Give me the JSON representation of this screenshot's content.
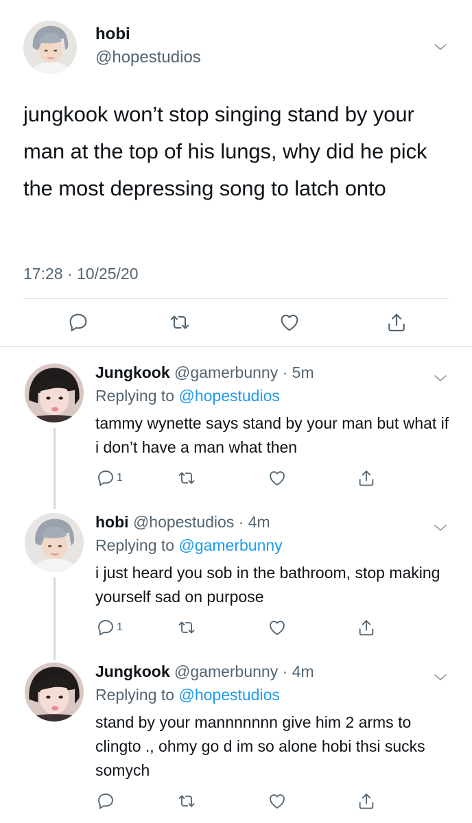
{
  "main_tweet": {
    "name": "hobi",
    "handle": "@hopestudios",
    "text": "jungkook won’t stop singing stand by your man at the top of his lungs, why did he pick the most depressing song to latch onto",
    "timestamp": "17:28 · 10/25/20"
  },
  "replies": [
    {
      "name": "Jungkook",
      "handle": "@gamerbunny",
      "time": " · 5m",
      "replying_prefix": "Replying to ",
      "replying_to": "@hopestudios",
      "text": "tammy wynette says stand by your man but what if i don’t have a man what then",
      "reply_count": "1"
    },
    {
      "name": "hobi",
      "handle": "@hopestudios",
      "time": " · 4m",
      "replying_prefix": "Replying to ",
      "replying_to": "@gamerbunny",
      "text": "i just heard you sob in the bathroom, stop making yourself sad on purpose",
      "reply_count": "1"
    },
    {
      "name": "Jungkook",
      "handle": "@gamerbunny",
      "time": " · 4m",
      "replying_prefix": "Replying to ",
      "replying_to": "@hopestudios",
      "text": "stand by your mannnnnnn give him 2 arms to clingto ., ohmy go d im so alone hobi thsi sucks somych",
      "reply_count": ""
    }
  ],
  "colors": {
    "text": "#0f1419",
    "secondary": "#536471",
    "link": "#1d9bf0",
    "divider": "#dcdfe2"
  },
  "icons": [
    "chevron-down-icon",
    "reply-icon",
    "retweet-icon",
    "like-icon",
    "share-icon"
  ]
}
